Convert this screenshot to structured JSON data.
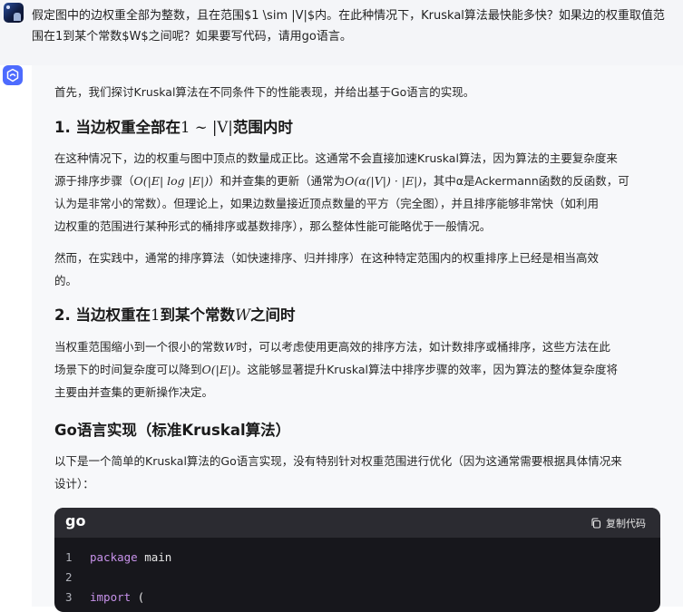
{
  "user": {
    "line1": "假定图中的边权重全部为整数，且在范围$1 \\sim |V|$内。在此种情况下，Kruskal算法最快能多快？如果边的权重取值范",
    "line2": "围在1到某个常数$W$之间呢？如果要写代码，请用go语言。"
  },
  "answer": {
    "intro": "首先，我们探讨Kruskal算法在不同条件下的性能表现，并给出基于Go语言的实现。",
    "h1_prefix": "1. 当边权重全部在",
    "h1_math": "1 ∼ |V|",
    "h1_suffix": "范围内时",
    "p1_l1": "在这种情况下，边的权重与图中顶点的数量成正比。这通常不会直接加速Kruskal算法，因为算法的主要复杂度来",
    "p1_l2a": "源于排序步骤（",
    "p1_l2m": "O(|E| log |E|)",
    "p1_l2b": "）和并查集的更新（通常为",
    "p1_l2m2": "O(α(|V|) · |E|)",
    "p1_l2c": "，其中α是Ackermann函数的反函数，可",
    "p1_l3": "认为是非常小的常数）。但理论上，如果边数量接近顶点数量的平方（完全图），并且排序能够非常快（如利用",
    "p1_l4": "边权重的范围进行某种形式的桶排序或基数排序），那么整体性能可能略优于一般情况。",
    "p2_l1": "然而，在实践中，通常的排序算法（如快速排序、归并排序）在这种特定范围内的权重排序上已经是相当高效",
    "p2_l2": "的。",
    "h2_prefix": "2. 当边权重在",
    "h2_math1": "1",
    "h2_mid": "到某个常数",
    "h2_math2": "W",
    "h2_suffix": "之间时",
    "p3_l1a": "当权重范围缩小到一个很小的常数",
    "p3_l1m": "W",
    "p3_l1b": "时，可以考虑使用更高效的排序方法，如计数排序或桶排序，这些方法在此",
    "p3_l2a": "场景下的时间复杂度可以降到",
    "p3_l2m": "O(|E|)",
    "p3_l2b": "。这能够显著提升Kruskal算法中排序步骤的效率，因为算法的整体复杂度将",
    "p3_l3": "主要由并查集的更新操作决定。",
    "h3": "Go语言实现（标准Kruskal算法）",
    "p4_l1": "以下是一个简单的Kruskal算法的Go语言实现，没有特别针对权重范围进行优化（因为这通常需要根据具体情况来",
    "p4_l2": "设计）："
  },
  "code": {
    "lang": "go",
    "copy_label": "复制代码",
    "lines": [
      {
        "n": "1",
        "kw": "package",
        "rest": " main"
      },
      {
        "n": "2",
        "kw": "",
        "rest": ""
      },
      {
        "n": "3",
        "kw": "import",
        "rest": " ("
      }
    ]
  },
  "colors": {
    "accent": "#4d6bfe",
    "code_bg": "#17171c",
    "keyword": "#c792ea"
  },
  "icons": {
    "assistant": "deepseek-whale-icon",
    "copy": "copy-icon"
  }
}
